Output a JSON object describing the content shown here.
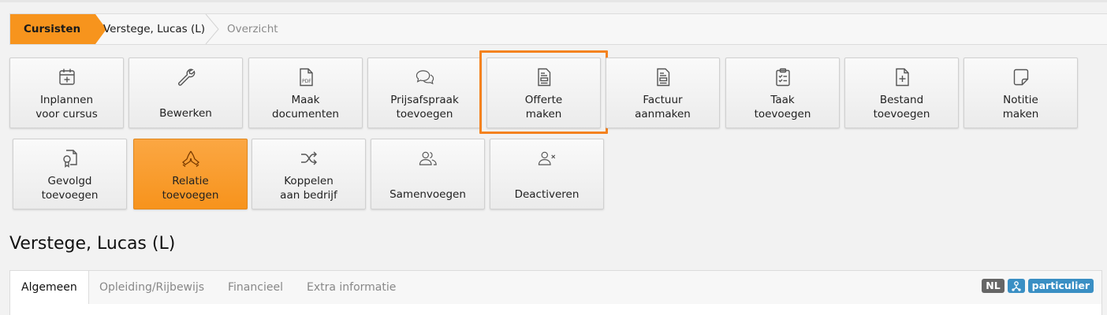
{
  "breadcrumb": {
    "items": [
      "Cursisten",
      "Verstege, Lucas (L)",
      "Overzicht"
    ]
  },
  "actions_row1": [
    {
      "label": "Inplannen\nvoor cursus",
      "icon": "calendar-plus-icon"
    },
    {
      "label": "Bewerken",
      "icon": "wrench-icon"
    },
    {
      "label": "Maak\ndocumenten",
      "icon": "pdf-file-icon"
    },
    {
      "label": "Prijsafspraak\ntoevoegen",
      "icon": "chat-bubbles-icon"
    },
    {
      "label": "Offerte\nmaken",
      "icon": "invoice-icon"
    },
    {
      "label": "Factuur\naanmaken",
      "icon": "invoice-icon"
    },
    {
      "label": "Taak\ntoevoegen",
      "icon": "clipboard-check-icon"
    },
    {
      "label": "Bestand\ntoevoegen",
      "icon": "file-plus-icon"
    },
    {
      "label": "Notitie\nmaken",
      "icon": "sticky-note-icon"
    }
  ],
  "actions_row2": [
    {
      "label": "Gevolgd\ntoevoegen",
      "icon": "certificate-icon"
    },
    {
      "label": "Relatie\ntoevoegen",
      "icon": "handshake-icon"
    },
    {
      "label": "Koppelen\naan bedrijf",
      "icon": "shuffle-icon"
    },
    {
      "label": "Samenvoegen",
      "icon": "users-icon"
    },
    {
      "label": "Deactiveren",
      "icon": "user-x-icon"
    }
  ],
  "page_title": "Verstege, Lucas (L)",
  "tabs": [
    "Algemeen",
    "Opleiding/Rijbewijs",
    "Financieel",
    "Extra informatie"
  ],
  "badges": {
    "language": "NL",
    "icon": "person-network-icon",
    "type": "particulier"
  },
  "colors": {
    "accent": "#f7941d",
    "badge_blue": "#3a8fc4",
    "badge_gray": "#666666"
  }
}
